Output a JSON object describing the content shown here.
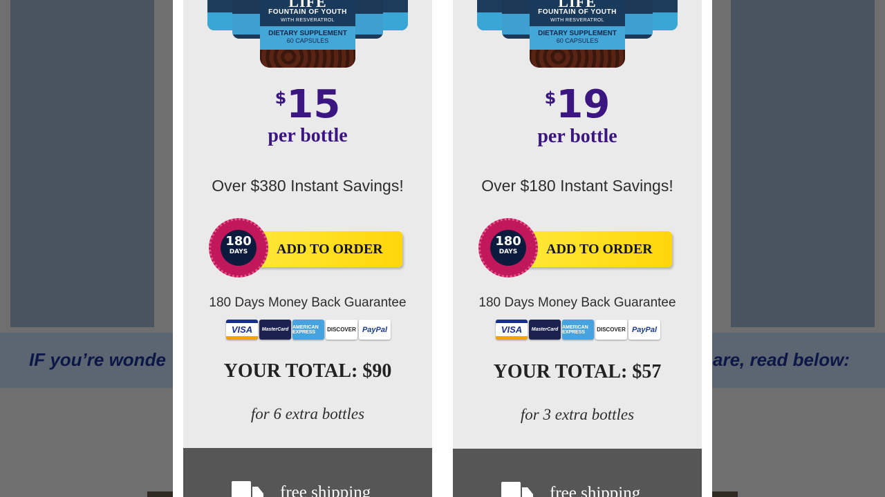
{
  "background": {
    "banner_left": "IF you’re wonde",
    "banner_right": "are, read below:"
  },
  "offers": [
    {
      "product": {
        "brand": "LIFE",
        "tagline": "FOUNTAIN OF YOUTH",
        "subtagline": "WITH RESVERATROL",
        "label_line1": "DIETARY SUPPLEMENT",
        "label_line2": "60 CAPSULES"
      },
      "currency": "$",
      "price": "15",
      "unit": "per bottle",
      "savings": "Over $380 Instant Savings!",
      "seal": {
        "number": "180",
        "unit": "DAYS"
      },
      "button_label": "ADD TO ORDER",
      "guarantee": "180 Days Money Back Guarantee",
      "total": "YOUR TOTAL: $90",
      "extra": "for 6 extra bottles",
      "shipping": "free shipping"
    },
    {
      "product": {
        "brand": "LIFE",
        "tagline": "FOUNTAIN OF YOUTH",
        "subtagline": "WITH RESVERATROL",
        "label_line1": "DIETARY SUPPLEMENT",
        "label_line2": "60 CAPSULES"
      },
      "currency": "$",
      "price": "19",
      "unit": "per bottle",
      "savings": "Over $180 Instant Savings!",
      "seal": {
        "number": "180",
        "unit": "DAYS"
      },
      "button_label": "ADD TO ORDER",
      "guarantee": "180 Days Money Back Guarantee",
      "total": "YOUR TOTAL: $57",
      "extra": "for 3 extra bottles",
      "shipping": "free shipping"
    }
  ],
  "payment_methods": [
    "VISA",
    "MasterCard",
    "AMERICAN EXPRESS",
    "DISCOVER",
    "PayPal"
  ],
  "colors": {
    "price_purple": "#3b1680",
    "button_yellow": "#ffe030",
    "seal_magenta": "#c0185a",
    "card_bg": "#eaeaea",
    "shipping_bar": "#565656"
  }
}
